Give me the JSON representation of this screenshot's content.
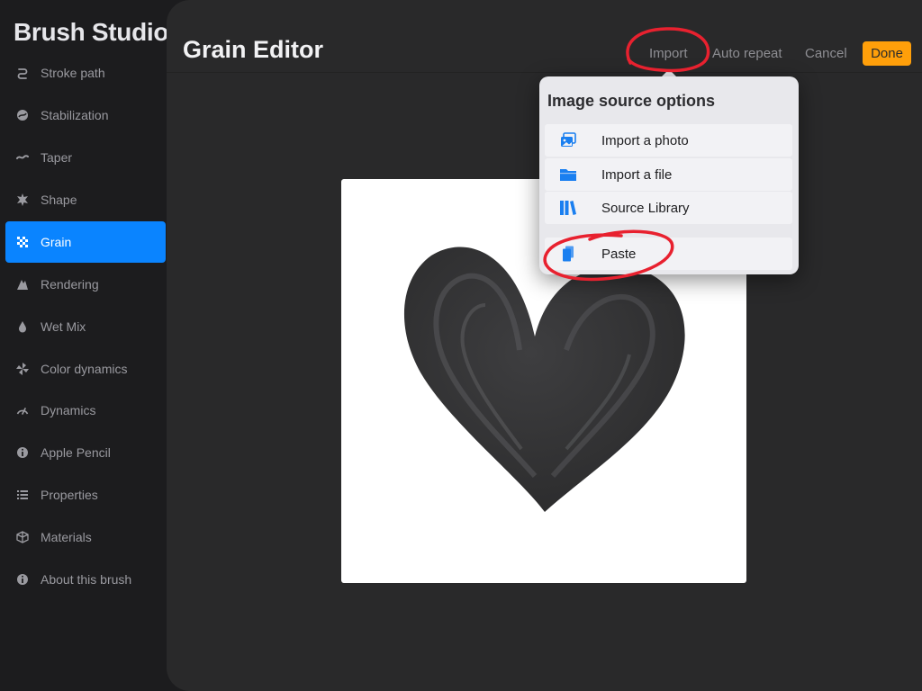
{
  "sidebar": {
    "title": "Brush Studio",
    "items": [
      {
        "label": "Stroke path",
        "icon": "stroke-path-icon"
      },
      {
        "label": "Stabilization",
        "icon": "stabilization-icon"
      },
      {
        "label": "Taper",
        "icon": "taper-icon"
      },
      {
        "label": "Shape",
        "icon": "shape-icon"
      },
      {
        "label": "Grain",
        "icon": "grain-icon",
        "active": true
      },
      {
        "label": "Rendering",
        "icon": "rendering-icon"
      },
      {
        "label": "Wet Mix",
        "icon": "wet-mix-icon"
      },
      {
        "label": "Color dynamics",
        "icon": "color-dynamics-icon"
      },
      {
        "label": "Dynamics",
        "icon": "dynamics-icon"
      },
      {
        "label": "Apple Pencil",
        "icon": "apple-pencil-icon"
      },
      {
        "label": "Properties",
        "icon": "properties-icon"
      },
      {
        "label": "Materials",
        "icon": "materials-icon"
      },
      {
        "label": "About this brush",
        "icon": "about-icon"
      }
    ]
  },
  "editor": {
    "title": "Grain Editor",
    "import_label": "Import",
    "auto_repeat_label": "Auto repeat",
    "cancel_label": "Cancel",
    "done_label": "Done"
  },
  "popover": {
    "title": "Image source options",
    "options": [
      {
        "label": "Import a photo",
        "icon": "photo-icon"
      },
      {
        "label": "Import a file",
        "icon": "folder-icon"
      },
      {
        "label": "Source Library",
        "icon": "library-icon"
      },
      {
        "label": "Paste",
        "icon": "paste-icon"
      }
    ]
  },
  "colors": {
    "accent": "#0a84ff",
    "done": "#ff9f0a",
    "annotation": "#e8212f"
  }
}
